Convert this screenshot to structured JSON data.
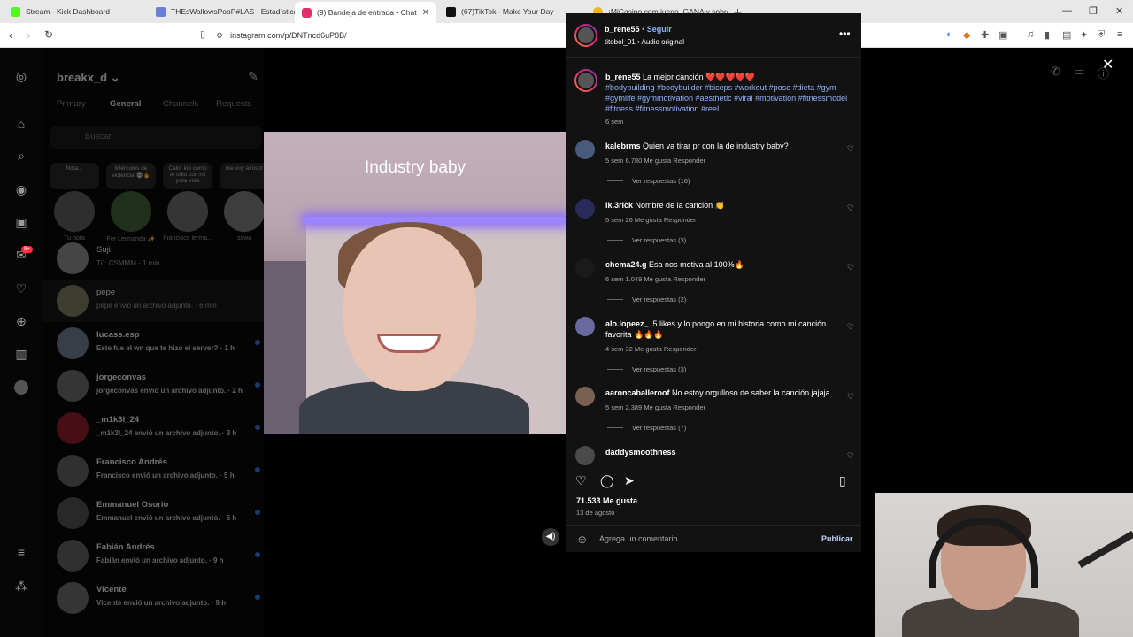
{
  "browser": {
    "tabs": [
      {
        "label": "Stream - Kick Dashboard",
        "color": "#53fc18"
      },
      {
        "label": "THEsWallowsPooP#LAS - Estadísticas",
        "color": "#6b7fd7"
      },
      {
        "label": "(9) Bandeja de entrada • Chat",
        "color": "#e1306c"
      },
      {
        "label": "(67)TikTok - Make Your Day",
        "color": "#111111"
      },
      {
        "label": "¡MiCasino.com juega, GANA y sobre",
        "color": "#f0b429"
      }
    ],
    "url": "instagram.com/p/DNTncd6uP8B/"
  },
  "dm": {
    "username": "breakx_d",
    "tabs": [
      "Primary",
      "General",
      "Channels",
      "Requests"
    ],
    "search_placeholder": "Buscar",
    "notes": [
      {
        "bubble": "Nota...",
        "name": "Tu nota"
      },
      {
        "bubble": "Miércoles de violencia 💀🔥",
        "name": "Fer Lermanda ✨"
      },
      {
        "bubble": "Calor kio como te odio con mi puta vida",
        "name": "Francisco lerma..."
      },
      {
        "bubble": "me voy a los tr",
        "name": "sawa"
      }
    ],
    "chats": [
      {
        "name": "Suji",
        "preview": "Tú: CSMMM · 1 min"
      },
      {
        "name": "pepe",
        "preview": "pepe envió un archivo adjunto. · 6 min"
      },
      {
        "name": "lucass.esp",
        "preview": "Este fue el wn que te hizo el server? · 1 h"
      },
      {
        "name": "jorgeconvas",
        "preview": "jorgeconvas envió un archivo adjunto. · 2 h"
      },
      {
        "name": "_m1k3l_24",
        "preview": "_m1k3l_24 envió un archivo adjunto. · 3 h"
      },
      {
        "name": "Francisco Andrés",
        "preview": "Francisco envió un archivo adjunto. · 5 h"
      },
      {
        "name": "Emmanuel Osorio",
        "preview": "Emmanuel envió un archivo adjunto. · 6 h"
      },
      {
        "name": "Fabián Andrés",
        "preview": "Fabián envió un archivo adjunto. · 9 h"
      },
      {
        "name": "Vicente",
        "preview": "Vicente envió un archivo adjunto. · 9 h"
      }
    ],
    "badge": "9+"
  },
  "video": {
    "caption": "Industry baby"
  },
  "post": {
    "author": "b_rene55",
    "follow": "Seguir",
    "audio": "titobol_01 • Audio original",
    "caption_text": "La mejor canción ❤️❤️❤️❤️❤️",
    "hashtags": "#bodybuilding #bodybuilder #biceps #workout #pose #dieta #gym #gymlife #gymmotivation #aesthetic #viral #motivation #fitnessmodel #fitness #fitnessmotivation #reel",
    "caption_time": "6 sem",
    "comments": [
      {
        "user": "kalebrms",
        "text": "Quien va tirar pr con la de industry baby?",
        "meta": "5 sem   6.780 Me gusta   Responder",
        "replies": "Ver respuestas (16)",
        "color": "#4a5a7a"
      },
      {
        "user": "lk.3rick",
        "text": "Nombre de la cancion 👏",
        "meta": "5 sem   26 Me gusta   Responder",
        "replies": "Ver respuestas (3)",
        "color": "#2a2a5a"
      },
      {
        "user": "chema24.g",
        "text": "Esa nos motiva al 100%🔥",
        "meta": "6 sem   1.049 Me gusta   Responder",
        "replies": "Ver respuestas (2)",
        "color": "#1a1a1a"
      },
      {
        "user": "alo.lopeez_",
        "text": ".5 likes y lo pongo en mi historia como mi canción favorita 🔥🔥🔥",
        "meta": "4 sem   32 Me gusta   Responder",
        "replies": "Ver respuestas (3)",
        "color": "#6a6aa0"
      },
      {
        "user": "aaroncaballeroof",
        "text": "No estoy orgulloso de saber la canción jajaja",
        "meta": "5 sem   2.389 Me gusta   Responder",
        "replies": "Ver respuestas (7)",
        "color": "#7a6050"
      },
      {
        "user": "daddysmoothness",
        "text": "",
        "meta": "",
        "replies": "",
        "color": "#4a4a4a"
      }
    ],
    "likes": "71.533 Me gusta",
    "date": "13 de agosto",
    "comment_placeholder": "Agrega un comentario...",
    "publish": "Publicar"
  }
}
